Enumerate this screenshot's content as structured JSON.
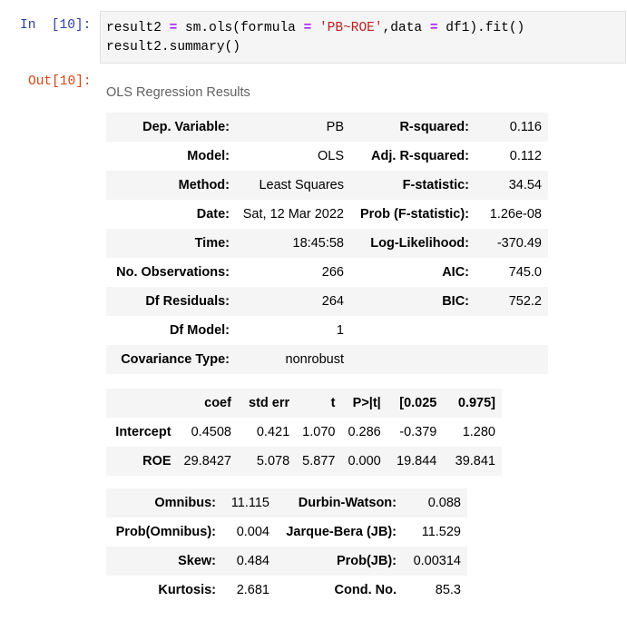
{
  "input_cell": {
    "prompt": "In  [10]:",
    "line1": {
      "var": "result2 ",
      "eq1": "=",
      "call": " sm.ols(formula ",
      "eq2": "=",
      "sp": " ",
      "formula_str": "'PB~ROE'",
      "mid": ",data ",
      "eq3": "=",
      "tail": " df1).fit()"
    },
    "line2": "result2.summary()"
  },
  "output_cell": {
    "prompt": "Out[10]:",
    "caption": "OLS Regression Results",
    "summary": [
      [
        "Dep. Variable:",
        "PB",
        "R-squared:",
        "0.116"
      ],
      [
        "Model:",
        "OLS",
        "Adj. R-squared:",
        "0.112"
      ],
      [
        "Method:",
        "Least Squares",
        "F-statistic:",
        "34.54"
      ],
      [
        "Date:",
        "Sat, 12 Mar 2022",
        "Prob (F-statistic):",
        "1.26e-08"
      ],
      [
        "Time:",
        "18:45:58",
        "Log-Likelihood:",
        "-370.49"
      ],
      [
        "No. Observations:",
        "266",
        "AIC:",
        "745.0"
      ],
      [
        "Df Residuals:",
        "264",
        "BIC:",
        "752.2"
      ],
      [
        "Df Model:",
        "1",
        "",
        ""
      ],
      [
        "Covariance Type:",
        "nonrobust",
        "",
        ""
      ]
    ],
    "coef_headers": [
      "",
      "coef",
      "std err",
      "t",
      "P>|t|",
      "[0.025",
      "0.975]"
    ],
    "coef_rows": [
      [
        "Intercept",
        "0.4508",
        "0.421",
        "1.070",
        "0.286",
        "-0.379",
        "1.280"
      ],
      [
        "ROE",
        "29.8427",
        "5.078",
        "5.877",
        "0.000",
        "19.844",
        "39.841"
      ]
    ],
    "diagnostics": [
      [
        "Omnibus:",
        "11.115",
        "Durbin-Watson:",
        "0.088"
      ],
      [
        "Prob(Omnibus):",
        "0.004",
        "Jarque-Bera (JB):",
        "11.529"
      ],
      [
        "Skew:",
        "0.484",
        "Prob(JB):",
        "0.00314"
      ],
      [
        "Kurtosis:",
        "2.681",
        "Cond. No.",
        "85.3"
      ]
    ]
  },
  "colors": {
    "in_prompt": "#303f9f",
    "out_prompt": "#d84315",
    "string": "#ba2121",
    "operator": "#aa22ff",
    "stripe": "#f5f5f5"
  }
}
